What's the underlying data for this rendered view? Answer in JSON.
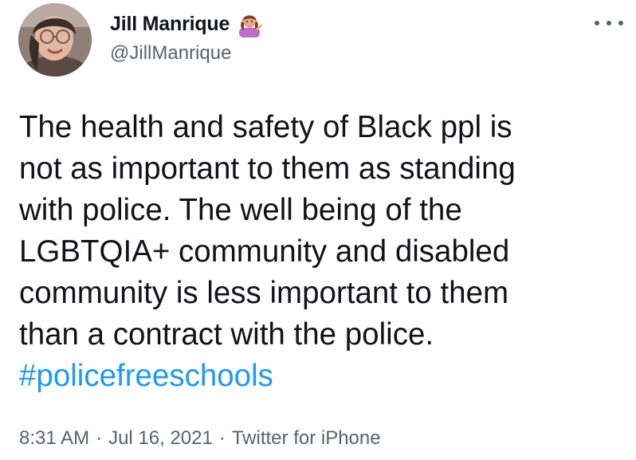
{
  "author": {
    "display_name": "Jill Manrique",
    "display_name_emoji": "person-tipping-hand-emoji",
    "handle": "@JillManrique"
  },
  "tweet": {
    "lines": [
      "The health and safety of Black ppl is",
      "not as important to them as standing",
      "with police. The well being of the",
      "LGBTQIA+ community and disabled",
      "community is less important to them",
      "than a contract with the police."
    ],
    "hashtag": "#policefreeschools"
  },
  "meta": {
    "time": "8:31 AM",
    "separator": "·",
    "date": "Jul 16, 2021",
    "source": "Twitter for iPhone"
  },
  "icons": {
    "more": "more-options-icon"
  },
  "colors": {
    "text": "#0f1419",
    "secondary": "#536471",
    "link": "#1d9bf0"
  }
}
